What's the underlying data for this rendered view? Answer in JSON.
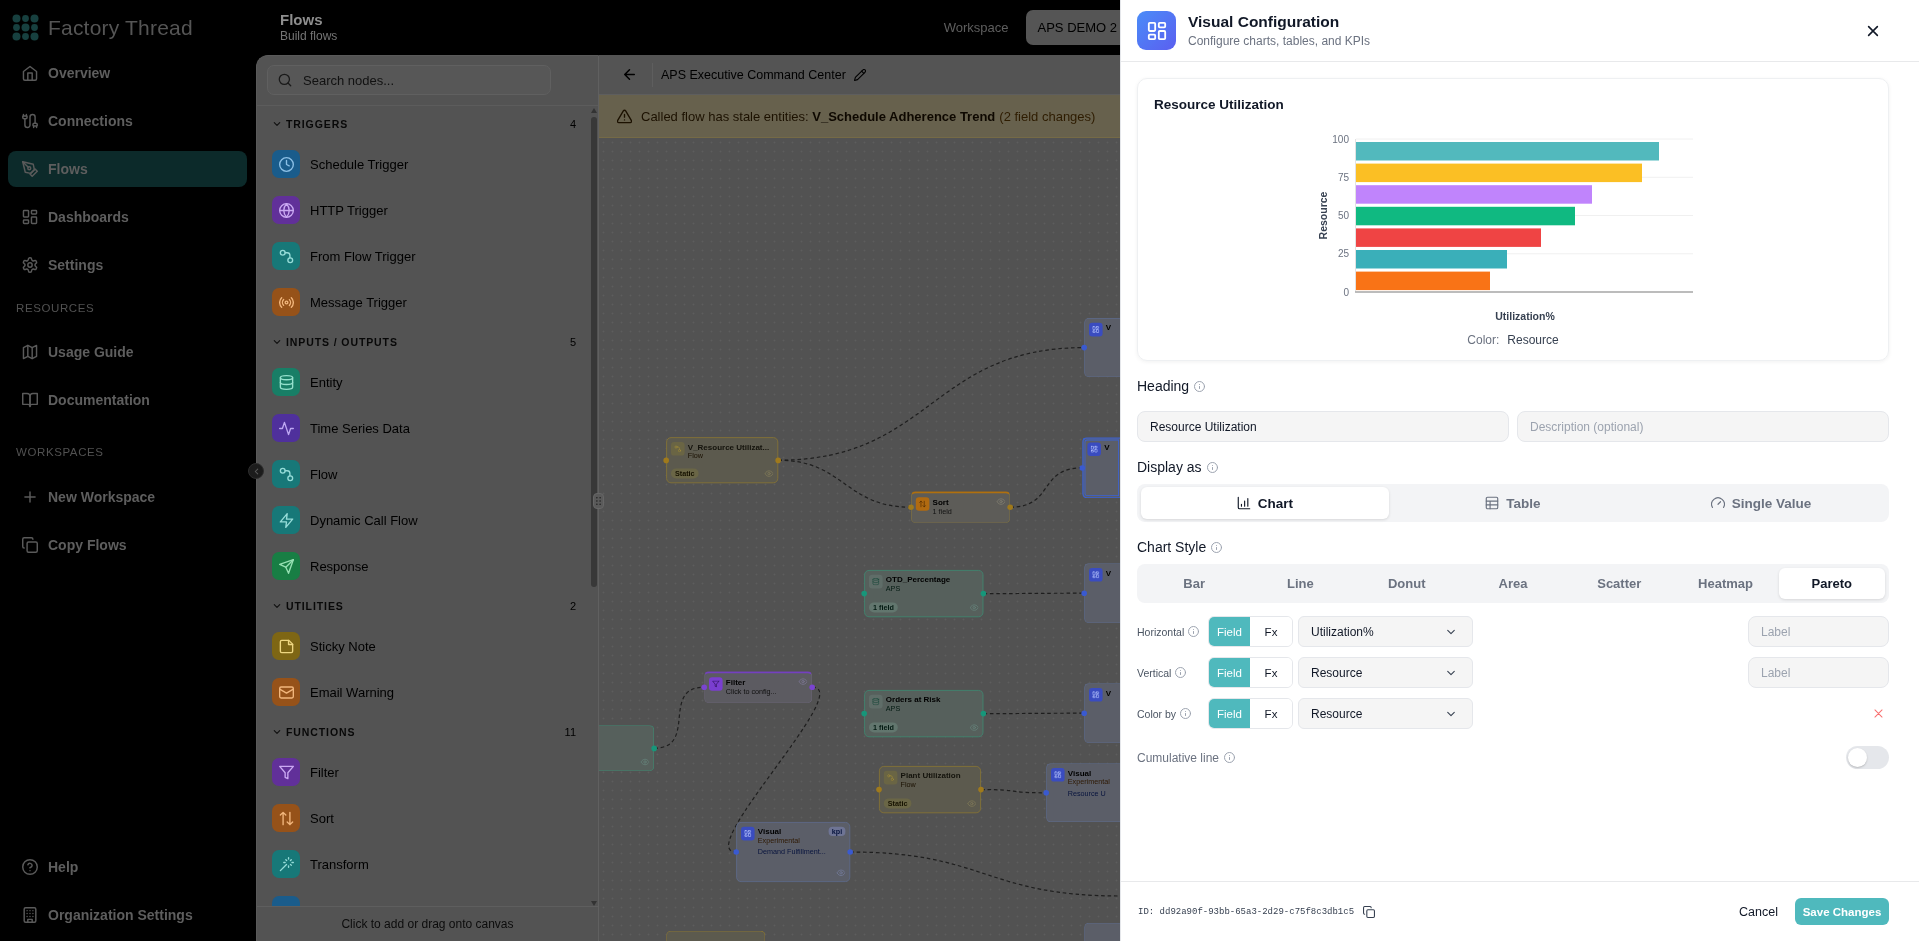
{
  "sidebar": {
    "brand": "Factory Thread",
    "items": [
      {
        "label": "Overview",
        "kind": "overview",
        "selected": false
      },
      {
        "label": "Connections",
        "kind": "connections",
        "selected": false
      },
      {
        "label": "Flows",
        "kind": "flows",
        "selected": true
      },
      {
        "label": "Dashboards",
        "kind": "dashboards",
        "selected": false
      },
      {
        "label": "Settings",
        "kind": "settings",
        "selected": false
      }
    ],
    "sections": [
      {
        "title": "RESOURCES",
        "items": [
          {
            "label": "Usage Guide",
            "kind": "guide",
            "selected": false
          },
          {
            "label": "Documentation",
            "kind": "docs",
            "selected": false
          }
        ]
      },
      {
        "title": "WORKSPACES",
        "items": [
          {
            "label": "New Workspace",
            "kind": "create",
            "selected": false
          },
          {
            "label": "Copy Flows",
            "kind": "copy",
            "selected": false
          }
        ]
      }
    ],
    "footer_items": [
      {
        "label": "Help",
        "kind": "help",
        "selected": false
      },
      {
        "label": "Organization Settings",
        "kind": "organization",
        "selected": false
      }
    ]
  },
  "header": {
    "title": "Flows",
    "subtitle": "Build flows",
    "workspace_label": "Workspace",
    "workspace": "APS DEMO 2"
  },
  "node_palette": {
    "search_placeholder": "Search nodes...",
    "groups": [
      {
        "title": "TRIGGERS",
        "count": "4",
        "expanded": true,
        "items": [
          {
            "label": "Schedule Trigger",
            "kind": "schedule"
          },
          {
            "label": "HTTP Trigger",
            "kind": "webhook"
          },
          {
            "label": "From Flow Trigger",
            "kind": "subflow"
          },
          {
            "label": "Message Trigger",
            "kind": "message"
          }
        ]
      },
      {
        "title": "INPUTS / OUTPUTS",
        "count": "5",
        "expanded": true,
        "items": [
          {
            "label": "Entity",
            "kind": "entity"
          },
          {
            "label": "Time Series Data",
            "kind": "timeseries"
          },
          {
            "label": "Flow",
            "kind": "flow"
          },
          {
            "label": "Dynamic Call Flow",
            "kind": "dynamic"
          },
          {
            "label": "Response",
            "kind": "response"
          }
        ]
      },
      {
        "title": "UTILITIES",
        "count": "2",
        "expanded": true,
        "items": [
          {
            "label": "Sticky Note",
            "kind": "note"
          },
          {
            "label": "Email Warning",
            "kind": "email"
          }
        ]
      },
      {
        "title": "FUNCTIONS",
        "count": "11",
        "expanded": true,
        "items": [
          {
            "label": "Filter",
            "kind": "filter"
          },
          {
            "label": "Sort",
            "kind": "sort"
          },
          {
            "label": "Transform",
            "kind": "transform"
          },
          {
            "kind": "partial"
          }
        ]
      }
    ],
    "hint": "Click to add or drag onto canvas"
  },
  "canvas": {
    "title": "APS Executive Command Center",
    "warning": {
      "message": "Called flow has stale entities: **V_Schedule Adherence Trend**",
      "detail": "(2 field changes)"
    },
    "nodes": [
      {
        "kind": "flow",
        "title": "V_Resource Utilizat...",
        "subtitle": "Flow",
        "badge": "Static",
        "selected": false
      },
      {
        "kind": "sort",
        "title": "Sort",
        "subtitle": "1 field",
        "selected": false
      },
      {
        "kind": "visual",
        "title": "V",
        "selected": false
      },
      {
        "kind": "visual",
        "title": "V",
        "selected": true
      },
      {
        "kind": "entity",
        "title": "OTD_Percentage",
        "subtitle": "APS",
        "badge": "1 field",
        "selected": false
      },
      {
        "kind": "visual",
        "title": "V",
        "selected": false
      },
      {
        "kind": "entity",
        "selected": false
      },
      {
        "kind": "filter",
        "title": "Filter",
        "subtitle": "Click to config...",
        "selected": false
      },
      {
        "kind": "entity",
        "title": "Orders at Risk",
        "subtitle": "APS",
        "badge": "1 field",
        "selected": false
      },
      {
        "kind": "visual",
        "title": "V",
        "selected": false
      },
      {
        "kind": "flow",
        "title": "Plant Utilization",
        "subtitle": "Flow",
        "badge": "Static",
        "selected": false
      },
      {
        "kind": "visual",
        "title": "Visual",
        "subtitle": "Experimental",
        "detail": "Resource U",
        "selected": false
      },
      {
        "kind": "visual",
        "title": "Visual",
        "subtitle": "Experimental",
        "detail": "Demand Fulfillment...",
        "badge": "kpi",
        "selected": false
      },
      {
        "kind": "flow",
        "selected": false
      },
      {
        "kind": "visual",
        "selected": false
      }
    ]
  },
  "config_panel": {
    "title": "Visual Configuration",
    "subtitle": "Configure charts, tables, and KPIs",
    "preview": {
      "title": "Resource Utilization",
      "y_axis_title": "Resource",
      "y_ticks": [
        "100",
        "75",
        "50",
        "25",
        "0"
      ],
      "x_axis_title": "Utilization%",
      "legend_label": "Color:",
      "legend_value": "Resource",
      "bars": [
        {
          "color": "#52b9bd"
        },
        {
          "color": "#fbbf24"
        },
        {
          "color": "#c084fc"
        },
        {
          "color": "#10b981"
        },
        {
          "color": "#ef4444"
        },
        {
          "color": "#3aafb9"
        },
        {
          "color": "#f97316"
        }
      ]
    },
    "heading": {
      "label": "Heading",
      "value": "Resource Utilization",
      "description_placeholder": "Description (optional)"
    },
    "display_as": {
      "label": "Display as",
      "options": [
        {
          "label": "Chart",
          "kind": "chart",
          "selected": true
        },
        {
          "label": "Table",
          "kind": "table",
          "selected": false
        },
        {
          "label": "Single Value",
          "kind": "single",
          "selected": false
        }
      ]
    },
    "chart_style": {
      "label": "Chart Style",
      "options": [
        {
          "label": "Bar",
          "selected": false
        },
        {
          "label": "Line",
          "selected": false
        },
        {
          "label": "Donut",
          "selected": false
        },
        {
          "label": "Area",
          "selected": false
        },
        {
          "label": "Scatter",
          "selected": false
        },
        {
          "label": "Heatmap",
          "selected": false
        },
        {
          "label": "Pareto",
          "selected": true
        }
      ]
    },
    "mappings": [
      {
        "label": "Horizontal",
        "modes": [
          {
            "label": "Field",
            "selected": true
          },
          {
            "label": "Fx",
            "selected": false
          }
        ],
        "value": "Utilization%",
        "label_placeholder": "Label",
        "removable": false
      },
      {
        "label": "Vertical",
        "modes": [
          {
            "label": "Field",
            "selected": true
          },
          {
            "label": "Fx",
            "selected": false
          }
        ],
        "value": "Resource",
        "label_placeholder": "Label",
        "removable": false
      },
      {
        "label": "Color by",
        "modes": [
          {
            "label": "Field",
            "selected": true
          },
          {
            "label": "Fx",
            "selected": false
          }
        ],
        "value": "Resource",
        "removable": true
      }
    ],
    "cumulative_line": {
      "label": "Cumulative line",
      "on": false
    },
    "footer": {
      "id_text": "ID: dd92a90f-93bb-65a3-2d29-c75f8c3db1c5",
      "cancel": "Cancel",
      "save": "Save Changes"
    }
  }
}
